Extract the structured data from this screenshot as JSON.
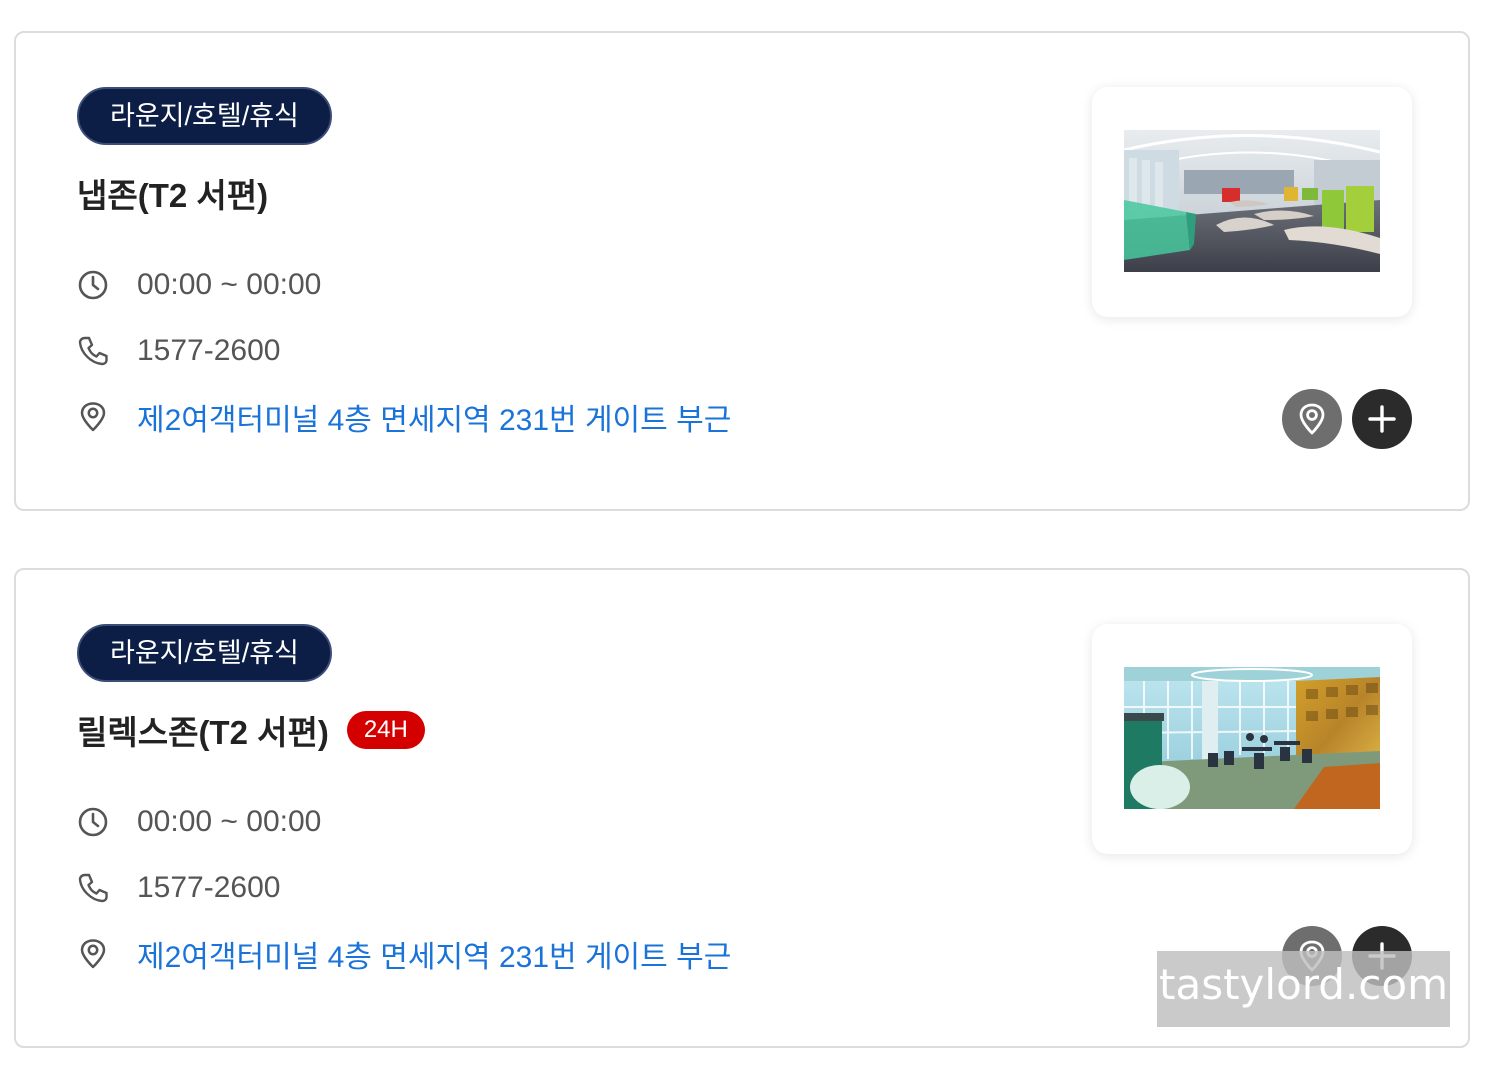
{
  "cards": [
    {
      "category": "라운지/호텔/휴식",
      "name": "냅존(T2 서편)",
      "hours": "00:00 ~ 00:00",
      "phone": "1577-2600",
      "location": "제2여객터미널 4층 면세지역 231번 게이트 부근",
      "thumbnail": "lounge-recliner-photo"
    },
    {
      "category": "라운지/호텔/휴식",
      "name": "릴렉스존(T2 서편)",
      "tag": "24H",
      "hours": "00:00 ~ 00:00",
      "phone": "1577-2600",
      "location": "제2여객터미널 4층 면세지역 231번 게이트 부근",
      "thumbnail": "lounge-cafe-photo"
    }
  ],
  "icons": {
    "hours": "clock-icon",
    "phone": "phone-icon",
    "location": "location-pin-icon",
    "map_button": "map-pin-icon",
    "add_button": "plus-icon"
  },
  "colors": {
    "badge_bg": "#0c1e46",
    "tag_24h_bg": "#d40000",
    "link": "#1a73d9",
    "map_button_bg": "#6e6e6e",
    "add_button_bg": "#2b2b2b"
  },
  "watermark": "tastylord.com"
}
